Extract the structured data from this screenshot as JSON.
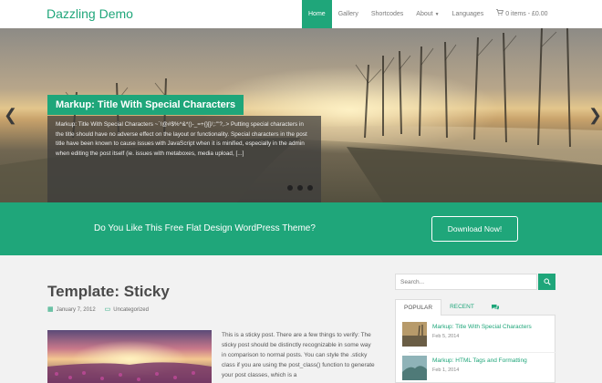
{
  "site": {
    "title": "Dazzling Demo"
  },
  "nav": {
    "items": [
      {
        "label": "Home"
      },
      {
        "label": "Gallery"
      },
      {
        "label": "Shortcodes"
      },
      {
        "label": "About"
      },
      {
        "label": "Languages"
      },
      {
        "label": "0 items - £0.00"
      }
    ]
  },
  "slider": {
    "title": "Markup: Title With Special Characters",
    "excerpt": "Markup: Title With Special Characters ~`!@#$%^&*()-_=+{}[]/;:'\"?,.> Putting special characters in the title should have no adverse effect on the layout or functionality. Special characters in the post title have been known to cause issues with JavaScript when it is minified, especially in the admin when editing the post itself (ie. issues with metaboxes, media upload, [...]",
    "slide_count": 3,
    "active_slide": 1
  },
  "cta": {
    "text": "Do You Like This Free Flat Design WordPress Theme?",
    "button": "Download Now!"
  },
  "post": {
    "title": "Template: Sticky",
    "date": "January 7, 2012",
    "category": "Uncategorized",
    "excerpt": "This is a sticky post. There are a few things to verify: The sticky post should be distinctly recognizable in some way in comparison to normal posts. You can style the .sticky class if you are using the post_class() function to generate your post classes, which is a"
  },
  "sidebar": {
    "search_placeholder": "Search...",
    "tabs": [
      {
        "label": "POPULAR"
      },
      {
        "label": "RECENT"
      }
    ],
    "posts": [
      {
        "title": "Markup: Title With Special Characters",
        "date": "Feb 5, 2014"
      },
      {
        "title": "Markup: HTML Tags and Formatting",
        "date": "Feb 1, 2014"
      }
    ]
  },
  "colors": {
    "accent": "#1fa67a"
  },
  "icons": {
    "calendar": "calendar-icon",
    "folder": "folder-icon",
    "search": "search-icon",
    "comments": "comments-icon",
    "cart": "cart-icon"
  }
}
